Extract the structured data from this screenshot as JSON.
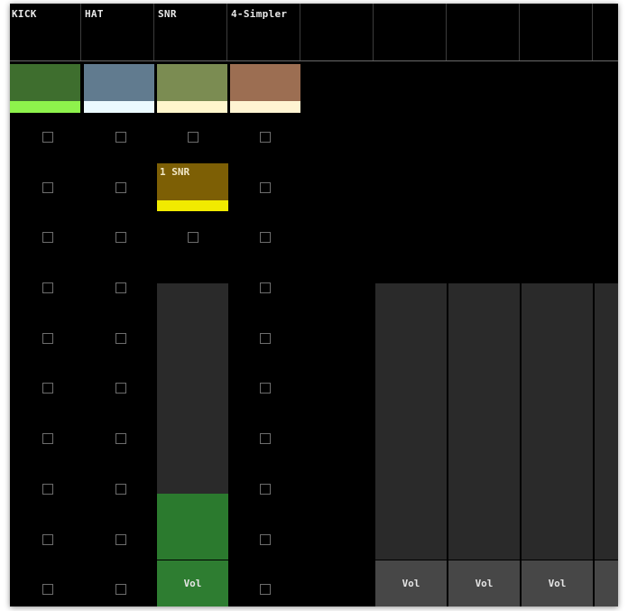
{
  "tracks": [
    {
      "name": "KICK",
      "color_top": "#3e6e2e",
      "color_bottom": "#8ef24c"
    },
    {
      "name": "HAT",
      "color_top": "#617b8f",
      "color_bottom": "#ebfaff"
    },
    {
      "name": "SNR",
      "color_top": "#7b8c52",
      "color_bottom": "#fff6cc"
    },
    {
      "name": "4-Simpler",
      "color_top": "#9c6e52",
      "color_bottom": "#fff4d2"
    }
  ],
  "clip": {
    "label": "1 SNR",
    "color": "#7d5f05",
    "bar_color": "#f1ea00"
  },
  "volume": {
    "label": "Vol",
    "snr_level": 0.24,
    "fill_color": "#2b7a2e"
  }
}
